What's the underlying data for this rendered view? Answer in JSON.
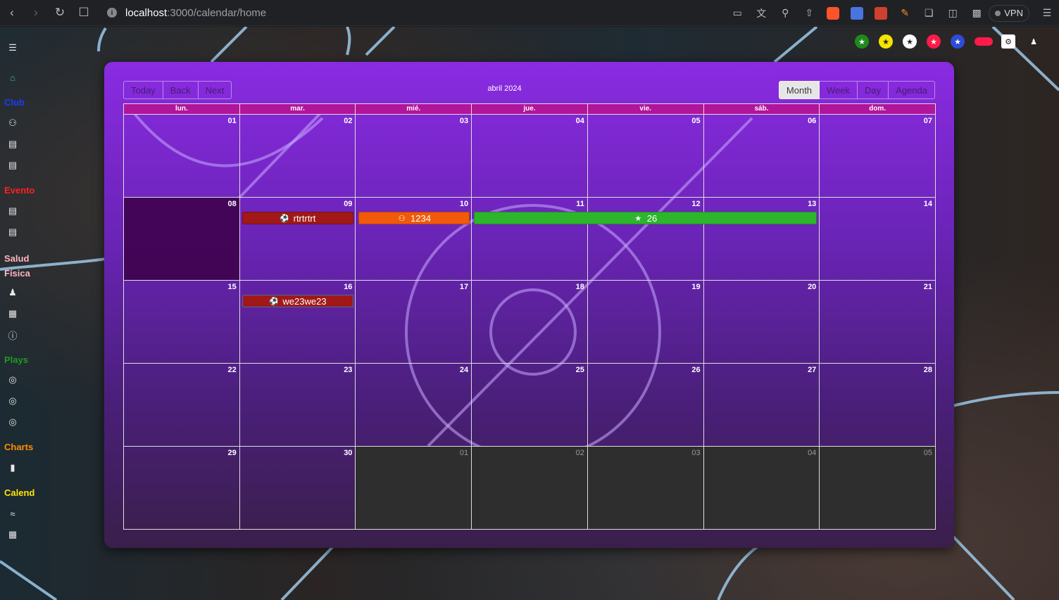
{
  "browser": {
    "url_host": "localhost",
    "url_path": ":3000/calendar/home",
    "vpn_label": "VPN"
  },
  "sidebar": {
    "sections": [
      {
        "heading": "Club",
        "color": "#1a3cff"
      },
      {
        "heading": "Evento",
        "color": "#ff2020"
      },
      {
        "heading": "Salud Física",
        "color": "#ffb6c1"
      },
      {
        "heading": "Plays",
        "color": "#1f9a1f"
      },
      {
        "heading": "Charts",
        "color": "#ff8c00"
      },
      {
        "heading": "Calend",
        "color": "#ffe600"
      }
    ]
  },
  "social_icons": [
    {
      "name": "green-star-icon",
      "color": "#1e8a1e"
    },
    {
      "name": "yellow-star-icon",
      "color": "#f5e400"
    },
    {
      "name": "white-star-icon",
      "color": "#ffffff"
    },
    {
      "name": "red-star-icon",
      "color": "#ff1a4a"
    },
    {
      "name": "blue-star-icon",
      "color": "#2d4bd8"
    }
  ],
  "calendar": {
    "label": "abril 2024",
    "nav_buttons": [
      "Today",
      "Back",
      "Next"
    ],
    "view_buttons": [
      "Month",
      "Week",
      "Day",
      "Agenda"
    ],
    "active_view": "Month",
    "weekdays": [
      "lun.",
      "mar.",
      "mié.",
      "jue.",
      "vie.",
      "sáb.",
      "dom."
    ],
    "weeks": [
      [
        "01",
        "02",
        "03",
        "04",
        "05",
        "06",
        "07"
      ],
      [
        "08",
        "09",
        "10",
        "11",
        "12",
        "13",
        "14"
      ],
      [
        "15",
        "16",
        "17",
        "18",
        "19",
        "20",
        "21"
      ],
      [
        "22",
        "23",
        "24",
        "25",
        "26",
        "27",
        "28"
      ],
      [
        "29",
        "30",
        "01",
        "02",
        "03",
        "04",
        "05"
      ]
    ],
    "events": [
      {
        "title": "rtrtrtrt",
        "icon": "basketball-icon",
        "color": "#a01818",
        "date": "09"
      },
      {
        "title": "1234",
        "icon": "team-icon",
        "color": "#f05a0a",
        "date": "10"
      },
      {
        "title": "26",
        "icon": "star-icon",
        "color": "#2eb52e",
        "start": "11",
        "end": "13"
      },
      {
        "title": "we23we23",
        "icon": "basketball-icon",
        "color": "#a01818",
        "date": "16"
      }
    ]
  }
}
